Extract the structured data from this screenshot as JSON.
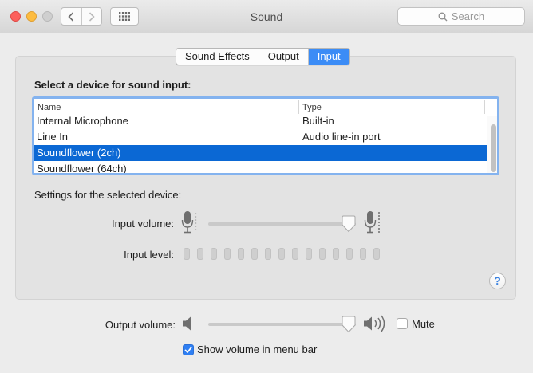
{
  "window": {
    "title": "Sound",
    "search_placeholder": "Search",
    "icons": {
      "close": "close-icon",
      "minimize": "minimize-icon",
      "zoom": "zoom-icon",
      "back": "chevron-left-icon",
      "forward": "chevron-right-icon",
      "show_all": "grid-icon",
      "search": "search-icon"
    }
  },
  "tabs": [
    {
      "label": "Sound Effects",
      "selected": false
    },
    {
      "label": "Output",
      "selected": false
    },
    {
      "label": "Input",
      "selected": true
    }
  ],
  "input": {
    "heading": "Select a device for sound input:",
    "columns": [
      "Name",
      "Type"
    ],
    "devices": [
      {
        "name": "Internal Microphone",
        "type": "Built-in",
        "selected": false
      },
      {
        "name": "Line In",
        "type": "Audio line-in port",
        "selected": false
      },
      {
        "name": "Soundflower (2ch)",
        "type": "",
        "selected": true
      },
      {
        "name": "Soundflower (64ch)",
        "type": "",
        "selected": false
      }
    ],
    "settings_label": "Settings for the selected device:",
    "input_volume_label": "Input volume:",
    "input_volume_value": 0.95,
    "input_level_label": "Input level:",
    "input_level_segments": 15,
    "input_level_active": 0,
    "help_label": "?"
  },
  "output": {
    "output_volume_label": "Output volume:",
    "output_volume_value": 0.95,
    "mute_label": "Mute",
    "mute_checked": false,
    "show_volume_label": "Show volume in menu bar",
    "show_volume_checked": true
  },
  "colors": {
    "accent": "#3b8cf6",
    "selection": "#0b68d4",
    "focus_ring": "#84b3ef"
  }
}
